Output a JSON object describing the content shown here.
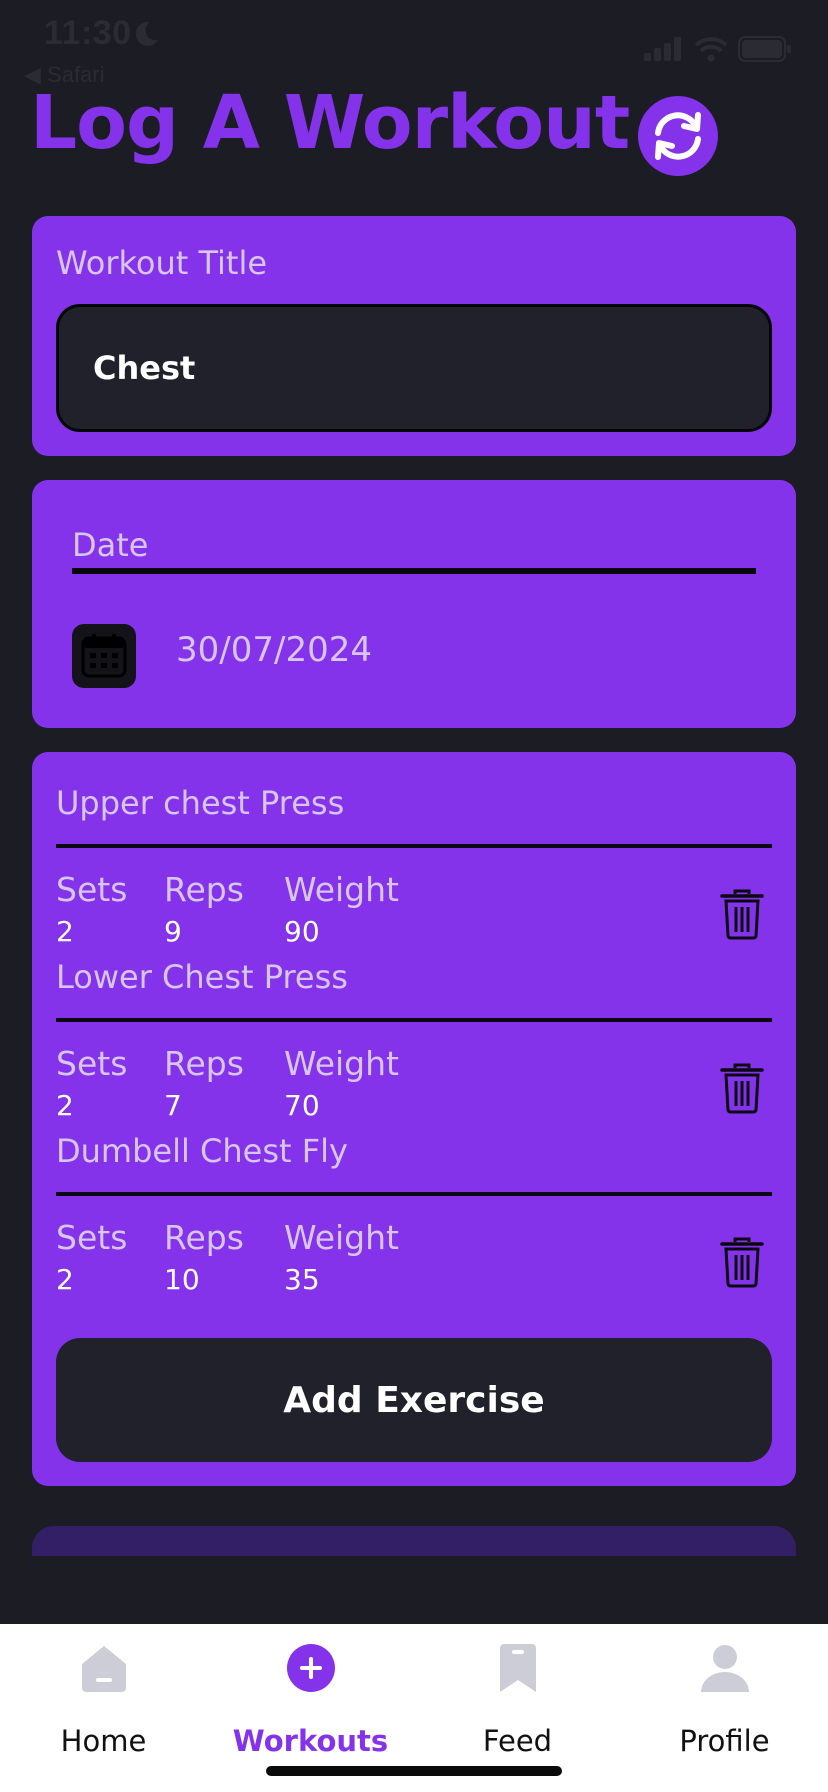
{
  "status_bar": {
    "time": "11:30",
    "back_label": "◀ Safari"
  },
  "header": {
    "title": "Log A Workout"
  },
  "workout_title": {
    "label": "Workout Title",
    "value": "Chest"
  },
  "date": {
    "label": "Date",
    "value": "30/07/2024"
  },
  "column_headers": {
    "sets": "Sets",
    "reps": "Reps",
    "weight": "Weight"
  },
  "exercises": [
    {
      "name": "Upper chest Press",
      "sets": "2",
      "reps": "9",
      "weight": "90"
    },
    {
      "name": "Lower Chest Press",
      "sets": "2",
      "reps": "7",
      "weight": "70"
    },
    {
      "name": "Dumbell Chest Fly",
      "sets": "2",
      "reps": "10",
      "weight": "35"
    }
  ],
  "add_exercise_label": "Add Exercise",
  "tabs": [
    {
      "label": "Home",
      "icon": "home-icon"
    },
    {
      "label": "Workouts",
      "icon": "add-circle-icon",
      "active": true
    },
    {
      "label": "Feed",
      "icon": "bookmark-icon"
    },
    {
      "label": "Profile",
      "icon": "person-icon"
    }
  ],
  "colors": {
    "accent": "#8433ea",
    "background": "#1c1c24",
    "field": "#21212b",
    "muted_text": "#d7c6f2"
  }
}
